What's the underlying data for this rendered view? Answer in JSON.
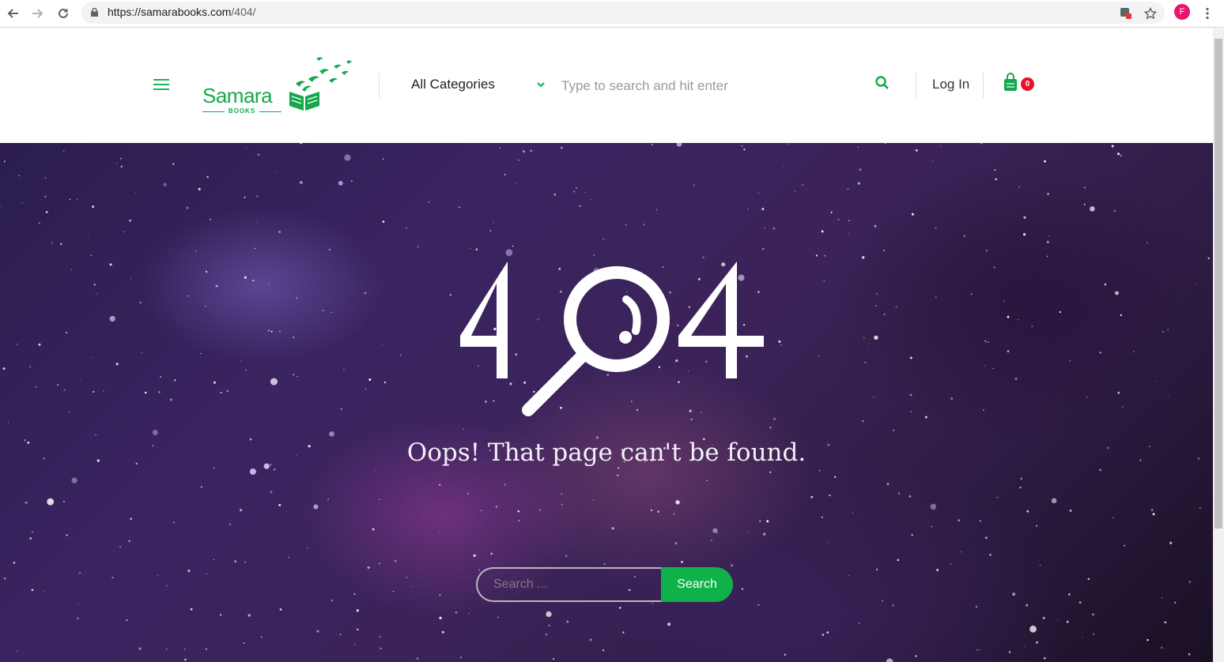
{
  "browser": {
    "url_host": "https://samarabooks.com",
    "url_path": "/404/",
    "profile_initial": "F",
    "icons": [
      "back-icon",
      "forward-icon",
      "reload-icon",
      "lock-icon",
      "translate-icon",
      "star-icon",
      "menu-dots-icon"
    ]
  },
  "header": {
    "logo_text": "Samara",
    "logo_sub": "BOOKS",
    "category_label": "All Categories",
    "search_placeholder": "Type to search and hit enter",
    "login_label": "Log In",
    "cart_count": "0"
  },
  "hero": {
    "message": "Oops! That page can't be found.",
    "search_placeholder": "Search ...",
    "search_button": "Search"
  },
  "colors": {
    "brand_green": "#13a94b",
    "button_green": "#0fb24a",
    "badge_red": "#e8102b"
  }
}
